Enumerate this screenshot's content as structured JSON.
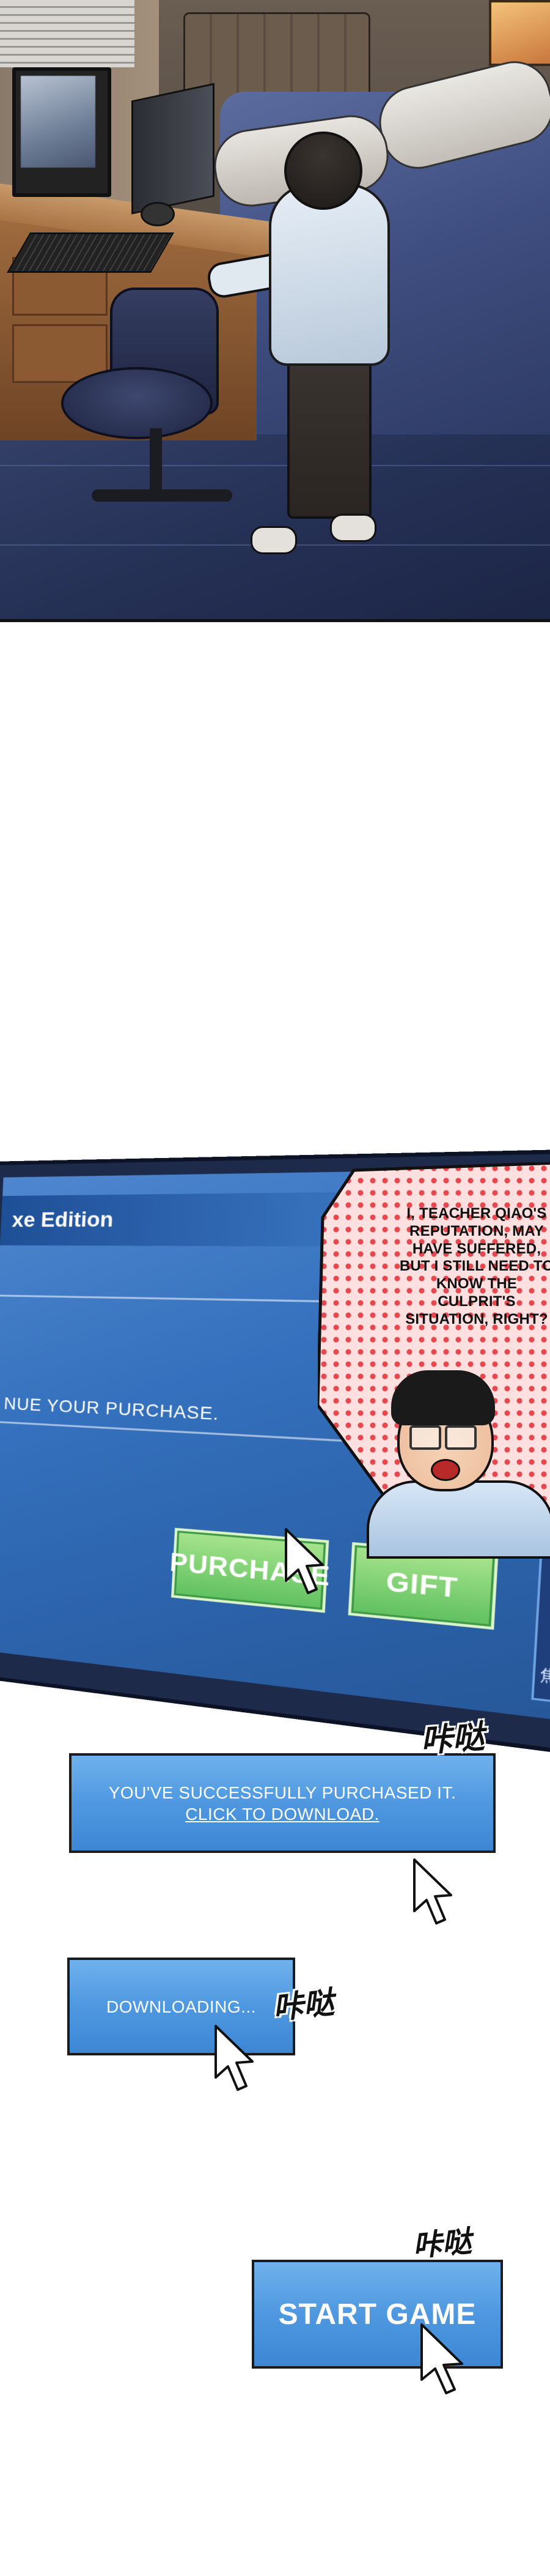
{
  "purchase_screen": {
    "title_fragment": "xe Edition",
    "note": "NUE YOUR PURCHASE.",
    "purchase_button": "PURCHASE",
    "gift_button": "GIFT",
    "side_glyph": "焦点"
  },
  "speech_bubble": {
    "text": "I, TEACHER QIAO'S REPUTATION, MAY HAVE SUFFERED, BUT I STILL NEED TO KNOW THE CULPRIT'S SITUATION, RIGHT?"
  },
  "notice_purchased": {
    "line1": "YOU'VE SUCCESSFULLY PURCHASED IT.",
    "link": "CLICK TO DOWNLOAD."
  },
  "notice_downloading": {
    "text": "DOWNLOADING..."
  },
  "notice_start": {
    "label": "START GAME"
  },
  "sound_effects": {
    "click_1": "咔哒",
    "click_2": "咔哒",
    "click_3": "咔哒"
  },
  "colors": {
    "notice_blue": "#4f98e0",
    "button_green": "#5fc05f",
    "halftone_red": "#e6484f"
  }
}
